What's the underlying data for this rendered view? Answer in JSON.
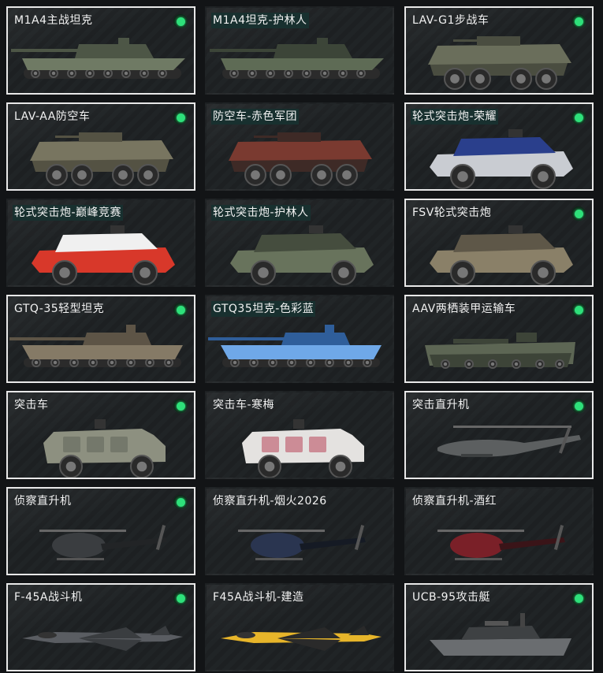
{
  "vehicles": [
    {
      "name": "M1A4主战坦克",
      "badge": true,
      "selected": true,
      "highlight": false,
      "kind": "tank",
      "colors": [
        "#6f7a64",
        "#4d5646"
      ]
    },
    {
      "name": "M1A4坦克-护林人",
      "badge": false,
      "selected": false,
      "highlight": true,
      "kind": "tank",
      "colors": [
        "#5e6b55",
        "#3c4538"
      ]
    },
    {
      "name": "LAV-G1步战车",
      "badge": true,
      "selected": true,
      "highlight": false,
      "kind": "apc",
      "colors": [
        "#6a6e5b",
        "#4a4d40"
      ]
    },
    {
      "name": "LAV-AA防空车",
      "badge": true,
      "selected": true,
      "highlight": false,
      "kind": "apc",
      "colors": [
        "#787560",
        "#545243"
      ]
    },
    {
      "name": "防空车-赤色军团",
      "badge": false,
      "selected": false,
      "highlight": true,
      "kind": "apc",
      "colors": [
        "#7a3a30",
        "#3e2a26"
      ]
    },
    {
      "name": "轮式突击炮-荣耀",
      "badge": true,
      "selected": true,
      "highlight": true,
      "kind": "jeep",
      "colors": [
        "#c9ccd2",
        "#2a3f8c"
      ]
    },
    {
      "name": "轮式突击炮-巅峰竞赛",
      "badge": false,
      "selected": false,
      "highlight": true,
      "kind": "jeep",
      "colors": [
        "#d8382a",
        "#f0f0f0"
      ]
    },
    {
      "name": "轮式突击炮-护林人",
      "badge": false,
      "selected": false,
      "highlight": true,
      "kind": "jeep",
      "colors": [
        "#68735c",
        "#454d3e"
      ]
    },
    {
      "name": "FSV轮式突击炮",
      "badge": true,
      "selected": true,
      "highlight": false,
      "kind": "jeep",
      "colors": [
        "#8a8068",
        "#5e5748"
      ]
    },
    {
      "name": "GTQ-35轻型坦克",
      "badge": true,
      "selected": true,
      "highlight": false,
      "kind": "lighttank",
      "colors": [
        "#857a66",
        "#5d5446"
      ]
    },
    {
      "name": "GTQ35坦克-色彩蓝",
      "badge": false,
      "selected": false,
      "highlight": true,
      "kind": "lighttank",
      "colors": [
        "#6fa8e8",
        "#2f5e9a"
      ]
    },
    {
      "name": "AAV两栖装甲运输车",
      "badge": true,
      "selected": true,
      "highlight": false,
      "kind": "aav",
      "colors": [
        "#5d6654",
        "#3d4438"
      ]
    },
    {
      "name": "突击车",
      "badge": true,
      "selected": true,
      "highlight": false,
      "kind": "truck",
      "colors": [
        "#8d9080",
        "#60645a"
      ]
    },
    {
      "name": "突击车-寒梅",
      "badge": false,
      "selected": false,
      "highlight": false,
      "kind": "truck",
      "colors": [
        "#e4e2e0",
        "#b8465a"
      ]
    },
    {
      "name": "突击直升机",
      "badge": true,
      "selected": true,
      "highlight": false,
      "kind": "attackheli",
      "colors": [
        "#5c5f60",
        "#3c3f40"
      ]
    },
    {
      "name": "侦察直升机",
      "badge": true,
      "selected": true,
      "highlight": false,
      "kind": "heli",
      "colors": [
        "#3a3d40",
        "#222426"
      ]
    },
    {
      "name": "侦察直升机-烟火2026",
      "badge": false,
      "selected": false,
      "highlight": false,
      "kind": "heli",
      "colors": [
        "#2a3550",
        "#151a24"
      ]
    },
    {
      "name": "侦察直升机-酒红",
      "badge": false,
      "selected": false,
      "highlight": false,
      "kind": "heli",
      "colors": [
        "#7a2028",
        "#3a1418"
      ]
    },
    {
      "name": "F-45A战斗机",
      "badge": true,
      "selected": true,
      "highlight": false,
      "kind": "jet",
      "colors": [
        "#5a5d62",
        "#3a3d40"
      ]
    },
    {
      "name": "F45A战斗机-建造",
      "badge": false,
      "selected": false,
      "highlight": false,
      "kind": "jet",
      "colors": [
        "#e7b52a",
        "#2a2a2a"
      ]
    },
    {
      "name": "UCB-95攻击艇",
      "badge": true,
      "selected": true,
      "highlight": false,
      "kind": "boat",
      "colors": [
        "#6a6d70",
        "#3e4143"
      ]
    }
  ]
}
